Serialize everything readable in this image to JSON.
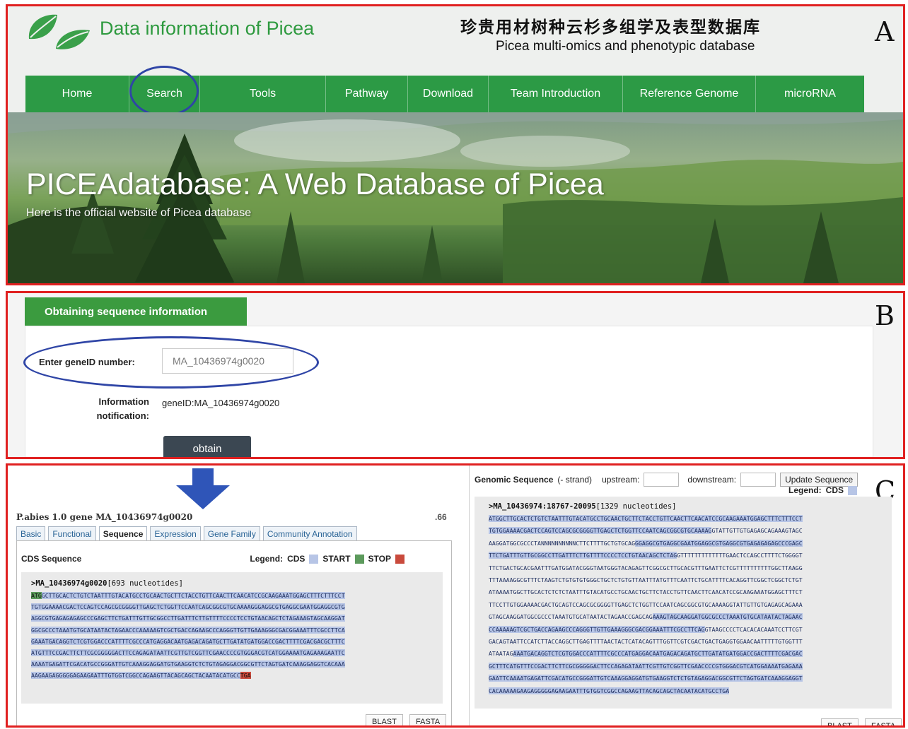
{
  "panel_a": {
    "letter": "A",
    "site_title": "Data information of Picea",
    "cn_title": "珍贵用材树种云杉多组学及表型数据库",
    "en_subtitle": "Picea multi-omics and phenotypic database",
    "nav": [
      "Home",
      "Search",
      "Tools",
      "Pathway",
      "Download",
      "Team Introduction",
      "Reference Genome",
      "microRNA"
    ],
    "hero_title": "PICEAdatabase: A Web Database of Picea",
    "hero_subtitle": "Here is the official website of Picea database",
    "colors": {
      "nav_green": "#2c9a45",
      "title_green": "#2e9a3f",
      "annotation_blue": "#2f45a6",
      "frame_red": "#e02020"
    }
  },
  "panel_b": {
    "letter": "B",
    "tab_title": "Obtaining sequence information",
    "gene_label": "Enter geneID number:",
    "gene_input": "MA_10436974g0020",
    "info_label": "Information notification:",
    "info_value": "geneID:MA_10436974g0020",
    "button": "obtain"
  },
  "panel_c": {
    "letter": "C",
    "gene_header": "P.abies 1.0 gene MA_10436974g0020",
    "version_note": ".66",
    "tabs": [
      "Basic",
      "Functional",
      "Sequence",
      "Expression",
      "Gene Family",
      "Community Annotation"
    ],
    "cds_title": "CDS Sequence",
    "legend_label": "Legend:",
    "legend_cds": "CDS",
    "legend_start": "START",
    "legend_stop": "STOP",
    "legend_colors": {
      "cds": "#b7c5e6",
      "start": "#5c9a5c",
      "stop": "#c94a3c"
    },
    "left_seq_id": ">MA_10436974g0020",
    "left_seq_len": "[693 nucleotides]",
    "left_lines": [
      {
        "start": "ATG",
        "cds": "GCTTGCACTCTGTCTAATTTGTACATGCCTGCAACTGCTTCTACCTGTTCAACTTCAACATCCGCAAGAAATGGAGCTTTCTTTCCT"
      },
      {
        "cds": "TGTGGAAAACGACTCCAGTCCAGCGCGGGGTTGAGCTCTGGTTCCAATCAGCGGCGTGCAAAAGGGAGGCGTGAGGCGAATGGAGGCGTG"
      },
      {
        "cds": "AGGCGTGAGAGAGAGCCCGAGCTTCTGATTTGTTGCGGCCTTGATTTCTTGTTTTCCCCTCCTGTAACAGCTCTAGAAAGTAGCAAGGAT"
      },
      {
        "cds": "GGCGCCCTAAATGTGCATAATACTAGAACCCAAAAAGTCGCTGACCAGAAGCCCAGGGTTGTTGAAAGGGCGACGGAAATTTCGCCTTCA"
      },
      {
        "cds": "GAAATGACAGGTCTCGTGGACCCATTTTCGCCCATGAGGACAATGAGACAGATGCTTGATATGATGGACCGACTTTTCGACGACGCTTTC"
      },
      {
        "cds": "ATGTTTCCGACTTCTTCGCGGGGGACTTCCAGAGATAATTCGTTGTCGGTTCGAACCCCGTGGGACGTCATGGAAAATGAGAAAGAATTC"
      },
      {
        "cds": "AAAATGAGATTCGACATGCCGGGATTGTCAAAGGAGGATGTGAAGGTCTCTGTAGAGGACGGCGTTCTAGTGATCAAAGGAGGTCACAAA"
      },
      {
        "cds": "AAGAAGAGGGGGAGAAGAATTTGTGGTCGGCCAGAAGTTACAGCAGCTACAATACATGCC",
        "stop": "TGA"
      }
    ],
    "blast": "BLAST",
    "fasta": "FASTA",
    "genomic_title": "Genomic Sequence",
    "strand": "(- strand)",
    "upstream_label": "upstream:",
    "downstream_label": "downstream:",
    "update_button": "Update Sequence",
    "right_seq_id": ">MA_10436974:18767-20095",
    "right_seq_len": "[1329 nucleotides]",
    "right_lines": [
      {
        "cds": "ATGGCTTGCACTCTGTCTAATTTGTACATGCCTGCAACTGCTTCTACCTGTTCAACTTCAACATCCGCAAGAAATGGAGCTTTCTTTCCT"
      },
      {
        "cds": "TGTGGAAAACGACTCCAGTCCAGCGCGGGGTTGAGCTCTGGTTCCAATCAGCGGCGTGCAAAAG",
        "plain": "GTATTGTTGTGAGAGCAGAAAGTAGC"
      },
      {
        "plain": "AAGGATGGCGCCCTANNNNNNNNNNCTTCTTTTGCTGTGCAG",
        "cds": "GGAGGCGTGAGGCGAATGGAGGCGTGAGGCGTGAGAGAGAGCCCGAGC"
      },
      {
        "cds": "TTCTGATTTGTTGCGGCCTTGATTTCTTGTTTTCCCCTCCTGTAACAGCTCTAG",
        "plain": "GTTTTTTTTTTTTTGAACTCCAGCCTTTTCTGGGGT"
      },
      {
        "plain": "TTCTGACTGCACGAATTTGATGGATACGGGTAATGGGTACAGAGTTCGGCGCTTGCACGTTTGAATTCTCGTTTTTTTTTTGGCTTAAGG"
      },
      {
        "plain": "TTTAAAAGGCGTTTCTAAGTCTGTGTGTGGGCTGCTCTGTGTTAATTTATGTTTCAATTCTGCATTTTCACAGGTTCGGCTCGGCTCTGT"
      },
      {
        "plain": "ATAAAATGGCTTGCACTCTCTCTAATTTGTACATGCCTGCAACTGCTTCTACCTGTTCAACTTCAACATCCGCAAGAAATGGAGCTTTCT"
      },
      {
        "plain": "TTCCTTGTGGAAAACGACTGCAGTCCAGCGCGGGGTTGAGCTCTGGTTCCAATCAGCGGCGTGCAAAAGGTATTGTTGTGAGAGCAGAAA"
      },
      {
        "plain": "GTAGCAAGGATGGCGCCCTAAATGTGCATAATACTAGAACCGAGCAG",
        "cds": "AAAGTAGCAAGGATGGCGCCCTAAATGTGCATAATACTAGAAC"
      },
      {
        "cds": "CCAAAAAGTCGCTGACCAGAAGCCCAGGGTTGTTGAAAGGGCGACGGAAATTTCGCCTTCAG",
        "plain": "GTAAGCCCCTCACACACAAATCCTTCGT"
      },
      {
        "plain": "GACAGTAATTCCATCTTACCAGGCTTGAGTTTTAACTACTCATACAGTTTGGTTCGTCGACTGACTGAGGTGGAACAATTTTTGTGGTTT"
      },
      {
        "plain": "ATAATAG",
        "cds": "AAATGACAGGTCTCGTGGACCCATTTTCGCCCATGAGGACAATGAGACAGATGCTTGATATGATGGACCGACTTTTCGACGAC"
      },
      {
        "cds": "GCTTTCATGTTTCCGACTTCTTCGCGGGGGACTTCCAGAGATAATTCGTTGTCGGTTCGAACCCCGTGGGACGTCATGGAAAATGAGAAA"
      },
      {
        "cds": "GAATTCAAAATGAGATTCGACATGCCGGGATTGTCAAAGGAGGATGTGAAGGTCTCTGTAGAGGACGGCGTTCTAGTGATCAAAGGAGGT"
      },
      {
        "cds": "CACAAAAAGAAGAGGGGGAGAAGAATTTGTGGTCGGCCAGAAGTTACAGCAGCTACAATACATGCCTGA"
      }
    ]
  }
}
